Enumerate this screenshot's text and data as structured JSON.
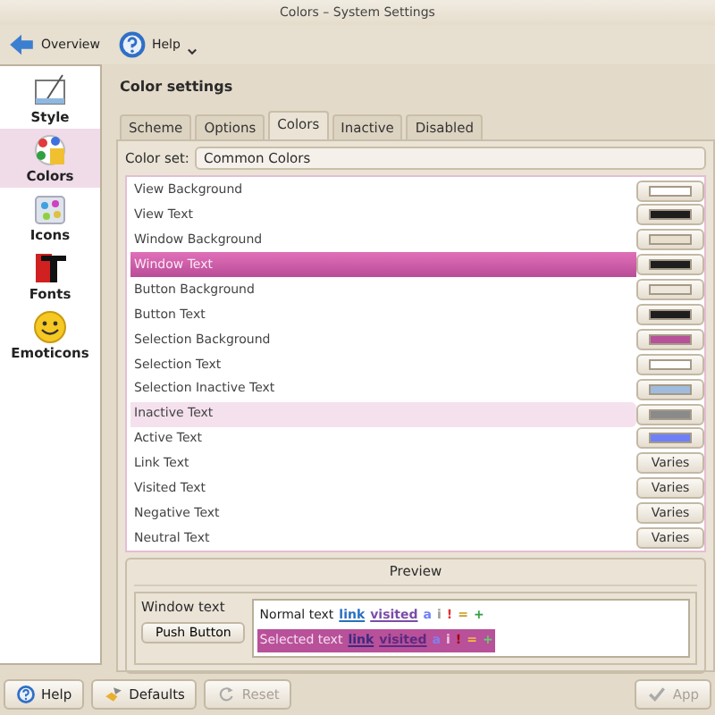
{
  "window": {
    "title": "Colors – System Settings"
  },
  "toolbar": [
    {
      "label": "Overview",
      "dropdown": false
    },
    {
      "label": "Help",
      "dropdown": true
    }
  ],
  "sidebar": {
    "items": [
      {
        "label": "Style",
        "selected": false
      },
      {
        "label": "Colors",
        "selected": true
      },
      {
        "label": "Icons",
        "selected": false
      },
      {
        "label": "Fonts",
        "selected": false
      },
      {
        "label": "Emoticons",
        "selected": false
      }
    ]
  },
  "heading": "Color settings",
  "tabs": [
    {
      "label": "Scheme",
      "selected": false
    },
    {
      "label": "Options",
      "selected": false
    },
    {
      "label": "Colors",
      "selected": true
    },
    {
      "label": "Inactive",
      "selected": false
    },
    {
      "label": "Disabled",
      "selected": false
    }
  ],
  "color_set": {
    "label": "Color set:",
    "value": "Common Colors"
  },
  "roles": [
    {
      "name": "View Background",
      "kind": "swatch",
      "color": "#ffffff",
      "selected": false,
      "hovered": false
    },
    {
      "name": "View Text",
      "kind": "swatch",
      "color": "#1e1e1e",
      "selected": false,
      "hovered": false
    },
    {
      "name": "Window Background",
      "kind": "swatch",
      "color": "#e8dfce",
      "selected": false,
      "hovered": false
    },
    {
      "name": "Window Text",
      "kind": "swatch",
      "color": "#1e1e1e",
      "selected": true,
      "hovered": false
    },
    {
      "name": "Button Background",
      "kind": "swatch",
      "color": "#ede6da",
      "selected": false,
      "hovered": false
    },
    {
      "name": "Button Text",
      "kind": "swatch",
      "color": "#1e1e1e",
      "selected": false,
      "hovered": false
    },
    {
      "name": "Selection Background",
      "kind": "swatch",
      "color": "#b9509a",
      "selected": false,
      "hovered": false
    },
    {
      "name": "Selection Text",
      "kind": "swatch",
      "color": "#ffffff",
      "selected": false,
      "hovered": false
    },
    {
      "name": "Selection Inactive Text",
      "kind": "swatch",
      "color": "#a0bcdc",
      "selected": false,
      "hovered": false
    },
    {
      "name": "Inactive Text",
      "kind": "swatch",
      "color": "#8a8a8a",
      "selected": false,
      "hovered": true
    },
    {
      "name": "Active Text",
      "kind": "swatch",
      "color": "#6e80f8",
      "selected": false,
      "hovered": false
    },
    {
      "name": "Link Text",
      "kind": "varies",
      "text": "Varies",
      "selected": false,
      "hovered": false
    },
    {
      "name": "Visited Text",
      "kind": "varies",
      "text": "Varies",
      "selected": false,
      "hovered": false
    },
    {
      "name": "Negative Text",
      "kind": "varies",
      "text": "Varies",
      "selected": false,
      "hovered": false
    },
    {
      "name": "Neutral Text",
      "kind": "varies",
      "text": "Varies",
      "selected": false,
      "hovered": false
    }
  ],
  "preview": {
    "title": "Preview",
    "label": "Window text",
    "button": "Push Button",
    "lines": [
      {
        "selected": false,
        "parts": [
          {
            "text": "Normal text",
            "kind": "plain",
            "color": "#1e1e1e"
          },
          {
            "text": "link",
            "kind": "link",
            "color": "#2a6fc0"
          },
          {
            "text": "visited",
            "kind": "link",
            "color": "#7a4ca8"
          },
          {
            "text": "a",
            "kind": "plain",
            "color": "#6e80f8"
          },
          {
            "text": "i",
            "kind": "plain",
            "color": "#a09a90"
          },
          {
            "text": "!",
            "kind": "plain",
            "color": "#e03030"
          },
          {
            "text": "=",
            "kind": "plain",
            "color": "#c89a20"
          },
          {
            "text": "+",
            "kind": "plain",
            "color": "#30a040"
          }
        ]
      },
      {
        "selected": true,
        "parts": [
          {
            "text": "Selected text",
            "kind": "plain",
            "color": "#f4e0ee"
          },
          {
            "text": "link",
            "kind": "link",
            "color": "#3a2a80"
          },
          {
            "text": "visited",
            "kind": "link",
            "color": "#5a2a80"
          },
          {
            "text": "a",
            "kind": "plain",
            "color": "#8080f0"
          },
          {
            "text": "i",
            "kind": "plain",
            "color": "#f0c8e0"
          },
          {
            "text": "!",
            "kind": "plain",
            "color": "#a00000"
          },
          {
            "text": "=",
            "kind": "plain",
            "color": "#f0c040"
          },
          {
            "text": "+",
            "kind": "plain",
            "color": "#60d070"
          }
        ]
      }
    ]
  },
  "buttons": [
    {
      "label": "Help",
      "disabled": false
    },
    {
      "label": "Defaults",
      "disabled": false
    },
    {
      "label": "Reset",
      "disabled": true
    },
    {
      "label": "App",
      "disabled": true
    }
  ]
}
